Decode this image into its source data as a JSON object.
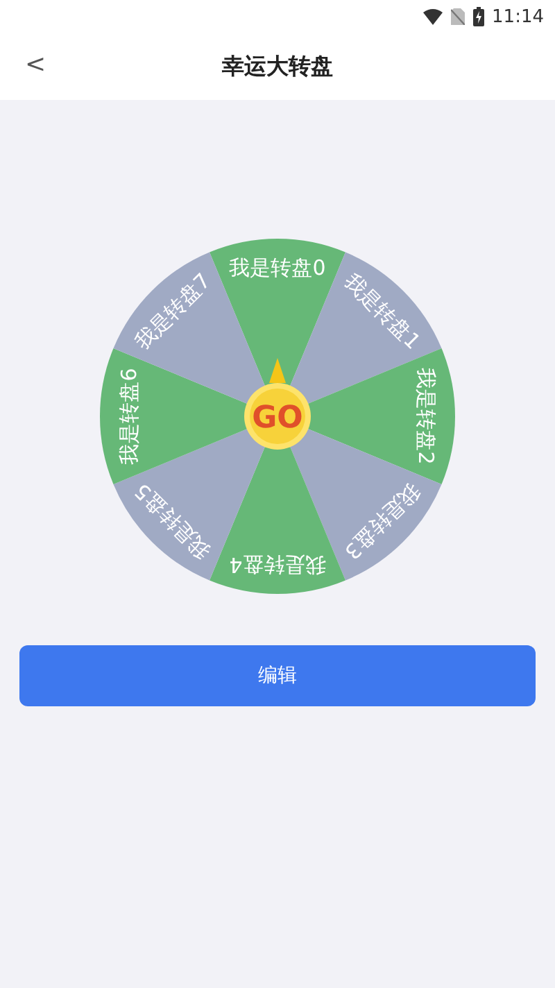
{
  "status_bar": {
    "time": "11:14"
  },
  "header": {
    "back": "<",
    "title": "幸运大转盘"
  },
  "wheel": {
    "center": "GO",
    "segments": [
      {
        "label": "我是转盘0",
        "color": "#66b877"
      },
      {
        "label": "我是转盘1",
        "color": "#a0aac4"
      },
      {
        "label": "我是转盘2",
        "color": "#66b877"
      },
      {
        "label": "我是转盘3",
        "color": "#a0aac4"
      },
      {
        "label": "我是转盘4",
        "color": "#66b877"
      },
      {
        "label": "我是转盘5",
        "color": "#a0aac4"
      },
      {
        "label": "我是转盘6",
        "color": "#66b877"
      },
      {
        "label": "我是转盘7",
        "color": "#a0aac4"
      }
    ]
  },
  "edit_button": "编辑"
}
